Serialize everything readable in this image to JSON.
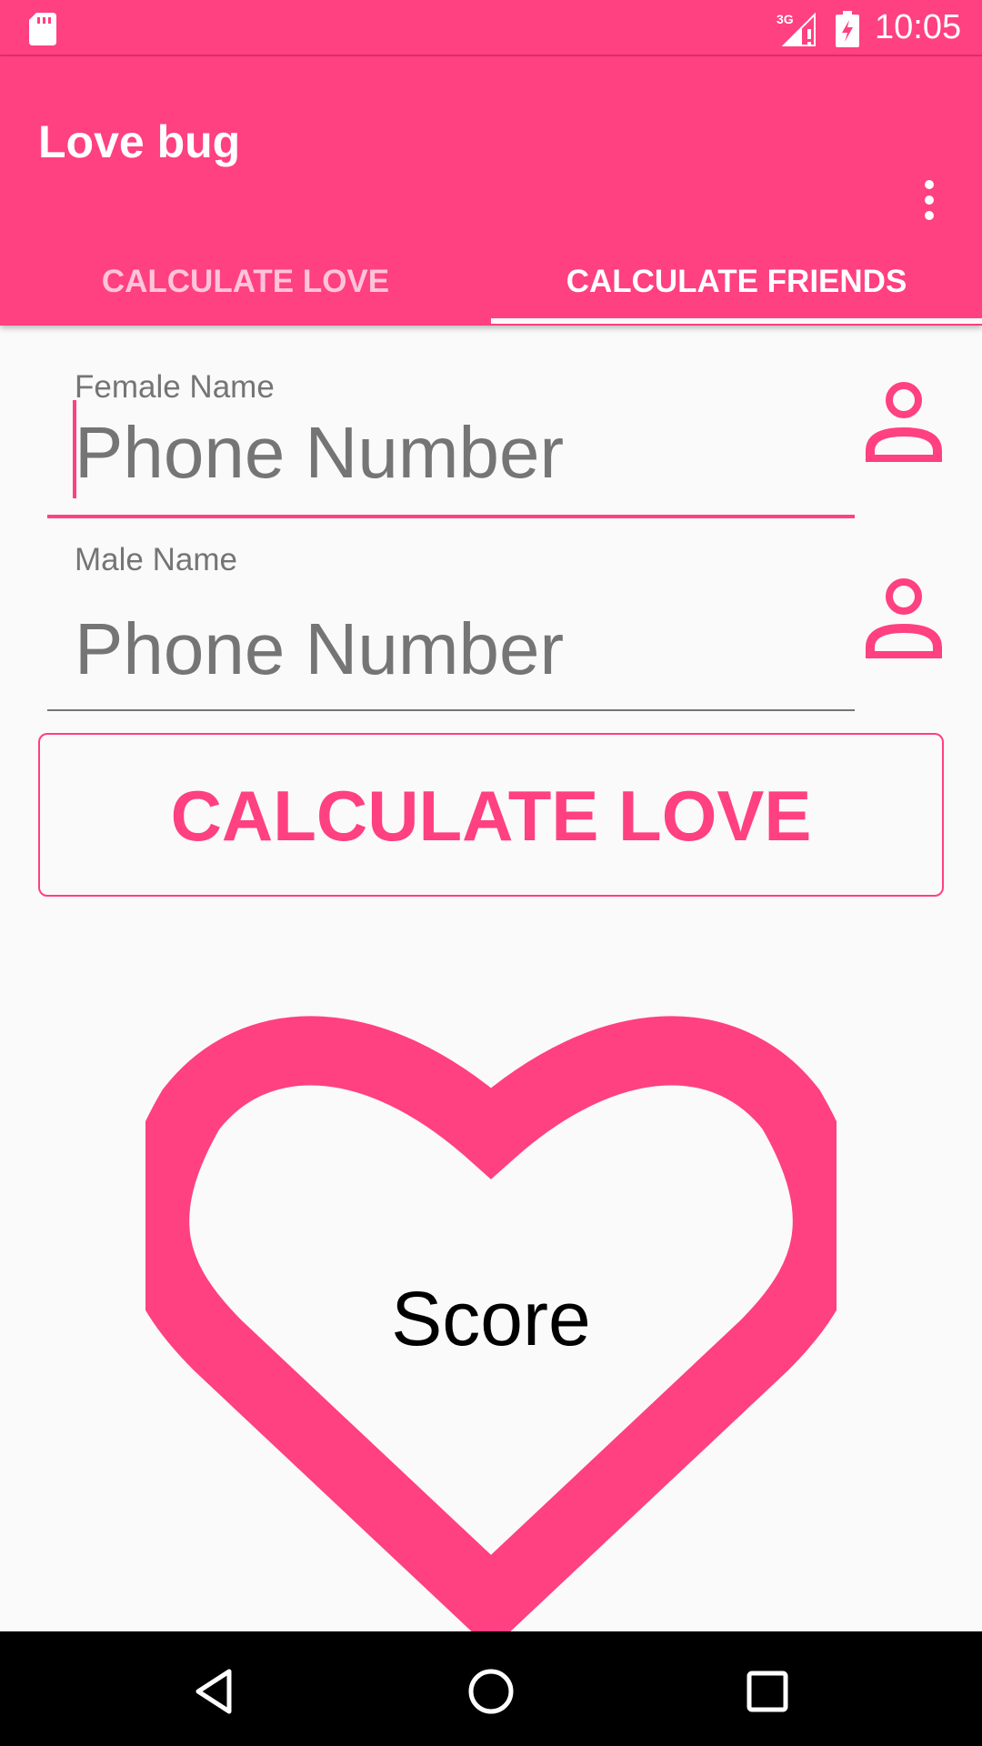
{
  "status_bar": {
    "time": "10:05",
    "network": "3G",
    "icons": [
      "sd-card-icon",
      "signal-icon",
      "battery-charging-icon"
    ]
  },
  "app_bar": {
    "title": "Love bug",
    "overflow_icon": "more-vert-icon"
  },
  "tabs": [
    {
      "label": "CALCULATE LOVE",
      "selected": false
    },
    {
      "label": "CALCULATE FRIENDS",
      "selected": true
    }
  ],
  "form": {
    "female": {
      "label": "Female Name",
      "placeholder": "Phone Number"
    },
    "male": {
      "label": "Male Name",
      "placeholder": "Phone Number"
    },
    "contact_icon": "person-outline-icon"
  },
  "button": {
    "label": "CALCULATE LOVE"
  },
  "result": {
    "label": "Score",
    "icon": "heart-outline-icon"
  },
  "nav_bar": {
    "icons": [
      "back-icon",
      "home-icon",
      "recents-icon"
    ]
  },
  "colors": {
    "accent": "#ff4081",
    "text_hint": "#757575",
    "background": "#fafafa"
  }
}
